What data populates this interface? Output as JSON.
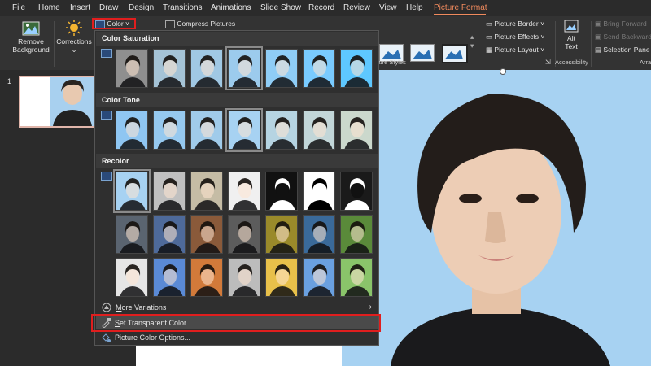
{
  "menu": {
    "tabs": [
      "File",
      "Home",
      "Insert",
      "Draw",
      "Design",
      "Transitions",
      "Animations",
      "Slide Show",
      "Record",
      "Review",
      "View",
      "Help",
      "Picture Format"
    ],
    "active_tab": "Picture Format"
  },
  "ribbon": {
    "remove_bg_line1": "Remove",
    "remove_bg_line2": "Background",
    "corrections": "Corrections",
    "color": "Color",
    "compress": "Compress Pictures",
    "picture_border": "Picture Border",
    "picture_effects": "Picture Effects",
    "picture_layout": "Picture Layout",
    "picture_styles_label": "icture Styles",
    "alt_text_line1": "Alt",
    "alt_text_line2": "Text",
    "accessibility_label": "Accessibility",
    "bring_forward": "Bring Forward",
    "send_backward": "Send Backward",
    "selection_pane": "Selection Pane",
    "arrange_label": "Arra"
  },
  "slides": {
    "number": "1"
  },
  "dropdown": {
    "color_saturation": "Color Saturation",
    "color_tone": "Color Tone",
    "recolor": "Recolor",
    "more_variations": "More Variations",
    "set_transparent": "Set Transparent Color",
    "picture_color_options": "Picture Color Options..."
  },
  "thumbs": {
    "saturation": [
      "#8f8f8f",
      "#a5c3d6",
      "#a0c8e4",
      "#9ccbed",
      "#8fcdf6",
      "#79cbff",
      "#5ec8ff"
    ],
    "tone": [
      "#8fc6f2",
      "#96c9ef",
      "#a0cbea",
      "#a7d2f2",
      "#b6d4e2",
      "#c2d6d8",
      "#cbd8cc"
    ],
    "recolor_row1": [
      "#a7d2f2",
      "#c0c0c0",
      "#c5bca5",
      "#f0f0f0",
      "#111111",
      "#ffffff",
      "#1a1a1a"
    ],
    "recolor_row2": [
      "#5a6470",
      "#4e6a9a",
      "#8a5a3a",
      "#5c5c5c",
      "#9a8a2a",
      "#3a6a9a",
      "#5a8a3a"
    ],
    "recolor_row3": [
      "#e6e6e6",
      "#5a8ad6",
      "#d27a3a",
      "#bcbcbc",
      "#e8c04a",
      "#6aa0e0",
      "#8ac46a"
    ]
  }
}
